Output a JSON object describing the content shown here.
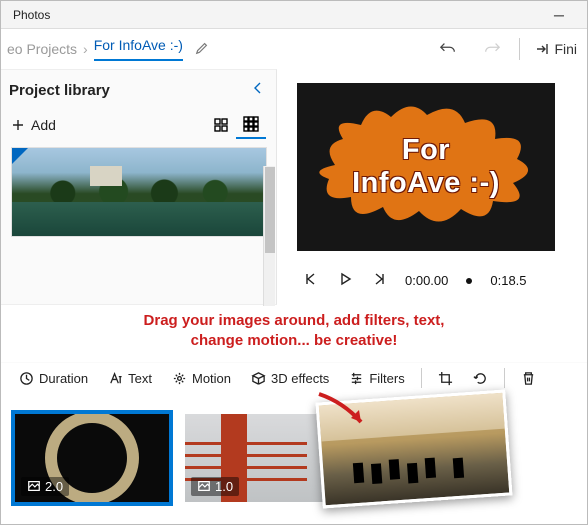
{
  "titlebar": {
    "app_name": "Photos"
  },
  "breadcrumb": {
    "prev": "eo Projects",
    "current": "For InfoAve :-)"
  },
  "topbar": {
    "finish": "Fini"
  },
  "sidebar": {
    "title": "Project library",
    "add": "Add"
  },
  "preview": {
    "overlay_line1": "For",
    "overlay_line2": "InfoAve :-)",
    "time_current": "0:00.00",
    "time_total": "0:18.5"
  },
  "annotation": {
    "line1": "Drag your images around, add filters, text,",
    "line2": "change motion... be creative!"
  },
  "toolbar": {
    "duration": "Duration",
    "text": "Text",
    "motion": "Motion",
    "effects": "3D effects",
    "filters": "Filters"
  },
  "clips": {
    "c1_dur": "2.0",
    "c2_dur": "1.0"
  }
}
